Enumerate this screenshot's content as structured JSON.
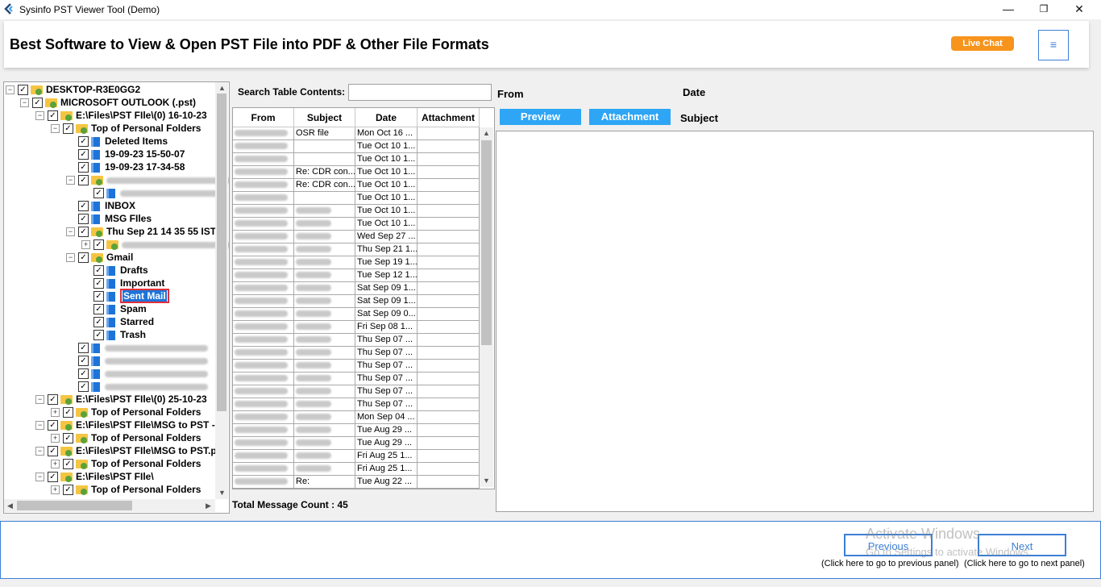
{
  "window": {
    "title": "Sysinfo PST Viewer Tool (Demo)",
    "minimize_label": "—",
    "maximize_label": "❐",
    "close_label": "✕"
  },
  "header": {
    "headline": "Best Software to View & Open PST File into PDF & Other File Formats",
    "live_chat_label": "Live Chat",
    "menu_label": "≡"
  },
  "tree": {
    "nodes": [
      {
        "expander": "−",
        "label": "DESKTOP-R3E0GG2",
        "icon": "computer-folder-icon"
      },
      {
        "expander": "−",
        "label": "MICROSOFT OUTLOOK (.pst)",
        "icon": "outlook-folder-icon"
      },
      {
        "expander": "−",
        "label": "E:\\Files\\PST FIle\\(0) 16-10-23",
        "icon": "pst-folder-icon"
      },
      {
        "expander": "−",
        "label": "Top of Personal Folders",
        "icon": "pst-folder-icon"
      },
      {
        "expander": "",
        "label": "Deleted Items",
        "icon": "mail-folder-icon"
      },
      {
        "expander": "",
        "label": "19-09-23 15-50-07",
        "icon": "mail-folder-icon"
      },
      {
        "expander": "",
        "label": "19-09-23 17-34-58",
        "icon": "mail-folder-icon"
      },
      {
        "expander": "−",
        "label": "",
        "icon": "pst-folder-icon"
      },
      {
        "expander": "",
        "label": "",
        "icon": "mail-folder-icon"
      },
      {
        "expander": "",
        "label": "INBOX",
        "icon": "mail-folder-icon"
      },
      {
        "expander": "",
        "label": "MSG FIles",
        "icon": "mail-folder-icon"
      },
      {
        "expander": "−",
        "label": "Thu Sep 21 14 35 55 IST",
        "icon": "pst-folder-icon"
      },
      {
        "expander": "+",
        "label": "",
        "icon": "pst-folder-icon"
      },
      {
        "expander": "−",
        "label": "Gmail",
        "icon": "pst-folder-icon"
      },
      {
        "expander": "",
        "label": "Drafts",
        "icon": "mail-folder-icon"
      },
      {
        "expander": "",
        "label": "Important",
        "icon": "mail-folder-icon"
      },
      {
        "expander": "",
        "label": "Sent Mail",
        "icon": "mail-folder-icon",
        "selected": true
      },
      {
        "expander": "",
        "label": "Spam",
        "icon": "mail-folder-icon"
      },
      {
        "expander": "",
        "label": "Starred",
        "icon": "mail-folder-icon"
      },
      {
        "expander": "",
        "label": "Trash",
        "icon": "mail-folder-icon"
      },
      {
        "expander": "",
        "label": "",
        "icon": "mail-folder-icon"
      },
      {
        "expander": "",
        "label": "",
        "icon": "mail-folder-icon"
      },
      {
        "expander": "",
        "label": "",
        "icon": "mail-folder-icon"
      },
      {
        "expander": "",
        "label": "",
        "icon": "mail-folder-icon"
      },
      {
        "expander": "−",
        "label": "E:\\Files\\PST FIle\\(0) 25-10-23",
        "icon": "pst-folder-icon"
      },
      {
        "expander": "+",
        "label": "Top of Personal Folders",
        "icon": "pst-folder-icon"
      },
      {
        "expander": "−",
        "label": "E:\\Files\\PST FIle\\MSG to PST -",
        "icon": "pst-folder-icon"
      },
      {
        "expander": "+",
        "label": "Top of Personal Folders",
        "icon": "pst-folder-icon"
      },
      {
        "expander": "−",
        "label": "E:\\Files\\PST FIle\\MSG to PST.p",
        "icon": "pst-folder-icon"
      },
      {
        "expander": "+",
        "label": "Top of Personal Folders",
        "icon": "pst-folder-icon"
      },
      {
        "expander": "−",
        "label": "E:\\Files\\PST FIle\\",
        "icon": "pst-folder-icon"
      },
      {
        "expander": "+",
        "label": "Top of Personal Folders",
        "icon": "pst-folder-icon"
      }
    ]
  },
  "search": {
    "label": "Search Table Contents:",
    "value": "",
    "placeholder": ""
  },
  "table": {
    "columns": [
      "From",
      "Subject",
      "Date",
      "Attachment"
    ],
    "rows": [
      {
        "from": "",
        "subject": "OSR file",
        "date": "Mon Oct 16 ...",
        "attachment": ""
      },
      {
        "from": "",
        "subject": "",
        "date": "Tue Oct 10 1...",
        "attachment": ""
      },
      {
        "from": "",
        "subject": "",
        "date": "Tue Oct 10 1...",
        "attachment": ""
      },
      {
        "from": "",
        "subject": "Re: CDR con...",
        "date": "Tue Oct 10 1...",
        "attachment": ""
      },
      {
        "from": "",
        "subject": "Re: CDR con...",
        "date": "Tue Oct 10 1...",
        "attachment": ""
      },
      {
        "from": "",
        "subject": "",
        "date": "Tue Oct 10 1...",
        "attachment": ""
      },
      {
        "from": "",
        "subject": "",
        "date": "Tue Oct 10 1...",
        "attachment": ""
      },
      {
        "from": "",
        "subject": "",
        "date": "Tue Oct 10 1...",
        "attachment": ""
      },
      {
        "from": "",
        "subject": "",
        "date": "Wed Sep 27 ...",
        "attachment": ""
      },
      {
        "from": "",
        "subject": "",
        "date": "Thu Sep 21 1...",
        "attachment": ""
      },
      {
        "from": "",
        "subject": "",
        "date": "Tue Sep 19 1...",
        "attachment": ""
      },
      {
        "from": "",
        "subject": "",
        "date": "Tue Sep 12 1...",
        "attachment": ""
      },
      {
        "from": "",
        "subject": "",
        "date": "Sat Sep 09 1...",
        "attachment": ""
      },
      {
        "from": "",
        "subject": "",
        "date": "Sat Sep 09 1...",
        "attachment": ""
      },
      {
        "from": "",
        "subject": "",
        "date": "Sat Sep 09 0...",
        "attachment": ""
      },
      {
        "from": "",
        "subject": "",
        "date": "Fri Sep 08 1...",
        "attachment": ""
      },
      {
        "from": "",
        "subject": "",
        "date": "Thu Sep 07 ...",
        "attachment": ""
      },
      {
        "from": "",
        "subject": "",
        "date": "Thu Sep 07 ...",
        "attachment": ""
      },
      {
        "from": "",
        "subject": "",
        "date": "Thu Sep 07 ...",
        "attachment": ""
      },
      {
        "from": "",
        "subject": "",
        "date": "Thu Sep 07 ...",
        "attachment": ""
      },
      {
        "from": "",
        "subject": "",
        "date": "Thu Sep 07 ...",
        "attachment": ""
      },
      {
        "from": "",
        "subject": "",
        "date": "Thu Sep 07 ...",
        "attachment": ""
      },
      {
        "from": "",
        "subject": "",
        "date": "Mon Sep 04 ...",
        "attachment": ""
      },
      {
        "from": "",
        "subject": "",
        "date": "Tue Aug 29 ...",
        "attachment": ""
      },
      {
        "from": "",
        "subject": "",
        "date": "Tue Aug 29 ...",
        "attachment": ""
      },
      {
        "from": "",
        "subject": "",
        "date": "Fri Aug 25 1...",
        "attachment": ""
      },
      {
        "from": "",
        "subject": "",
        "date": "Fri Aug 25 1...",
        "attachment": ""
      },
      {
        "from": "",
        "subject": "Re:",
        "date": "Tue Aug 22 ...",
        "attachment": ""
      }
    ],
    "total_label": "Total Message Count : 45"
  },
  "preview": {
    "from_label": "From",
    "date_label": "Date",
    "subject_label": "Subject",
    "preview_button": "Preview",
    "attachment_button": "Attachment"
  },
  "footer": {
    "previous_label": "Previous",
    "next_label": "Next",
    "previous_hint": "(Click here to go to previous panel)",
    "next_hint": "(Click here to go to next panel)",
    "watermark_line1": "Activate Windows",
    "watermark_line2": "Go to Settings to activate Windows."
  },
  "colors": {
    "accent_blue": "#2ea6f5",
    "border_blue": "#3c7fd6",
    "live_chat_orange": "#f7941d",
    "selection_red": "#e0303a"
  }
}
